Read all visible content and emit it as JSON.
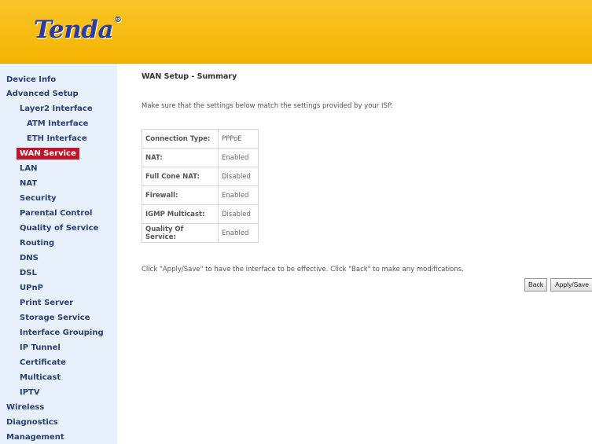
{
  "header": {
    "logo_text": "Tenda",
    "logo_mark": "®"
  },
  "sidebar": {
    "items": [
      {
        "label": "Device Info"
      },
      {
        "label": "Advanced Setup"
      },
      {
        "label": "Layer2 Interface"
      },
      {
        "label": "ATM Interface"
      },
      {
        "label": "ETH Interface"
      },
      {
        "label": "WAN Service",
        "active": true
      },
      {
        "label": "LAN"
      },
      {
        "label": "NAT"
      },
      {
        "label": "Security"
      },
      {
        "label": "Parental Control"
      },
      {
        "label": "Quality of Service"
      },
      {
        "label": "Routing"
      },
      {
        "label": "DNS"
      },
      {
        "label": "DSL"
      },
      {
        "label": "UPnP"
      },
      {
        "label": "Print Server"
      },
      {
        "label": "Storage Service"
      },
      {
        "label": "Interface Grouping"
      },
      {
        "label": "IP Tunnel"
      },
      {
        "label": "Certificate"
      },
      {
        "label": "Multicast"
      },
      {
        "label": "IPTV"
      },
      {
        "label": "Wireless"
      },
      {
        "label": "Diagnostics"
      },
      {
        "label": "Management"
      }
    ]
  },
  "main": {
    "title": "WAN Setup - Summary",
    "intro": "Make sure that the settings below match the settings provided by your ISP.",
    "rows": [
      {
        "label": "Connection Type:",
        "value": "PPPoE"
      },
      {
        "label": "NAT:",
        "value": "Enabled"
      },
      {
        "label": "Full Cone NAT:",
        "value": "Disabled"
      },
      {
        "label": "Firewall:",
        "value": "Enabled"
      },
      {
        "label": "IGMP Multicast:",
        "value": "Disabled"
      },
      {
        "label": "Quality Of Service:",
        "value": "Enabled"
      }
    ],
    "note": "Click \"Apply/Save\" to have the interface to be effective. Click \"Back\" to make any modifications.",
    "back_label": "Back",
    "apply_label": "Apply/Save"
  },
  "colors": {
    "header": "#f5b400",
    "sidebar_bg": "#e7f1fb",
    "active_bg": "#c0162c",
    "logo": "#2f3c9b"
  }
}
